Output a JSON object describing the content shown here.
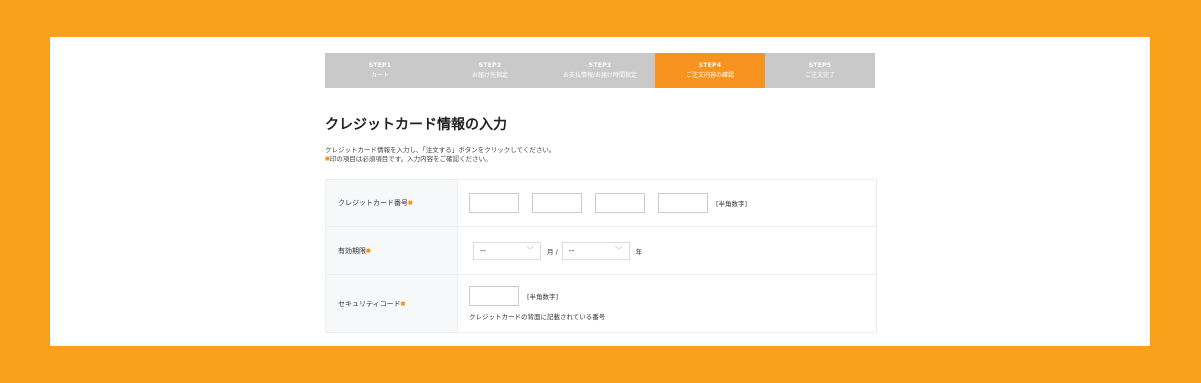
{
  "steps": [
    {
      "num": "STEP1",
      "label": "カート",
      "active": false
    },
    {
      "num": "STEP2",
      "label": "お届け先指定",
      "active": false
    },
    {
      "num": "STEP3",
      "label": "お支払情報/お届け時間指定",
      "active": false
    },
    {
      "num": "STEP4",
      "label": "ご注文内容の確認",
      "active": true
    },
    {
      "num": "STEP5",
      "label": "ご注文完了",
      "active": false
    }
  ],
  "title": "クレジットカード情報の入力",
  "desc": {
    "line1": "クレジットカード情報を入力し、「注文する」ボタンをクリックしてください。",
    "required_mark": "■",
    "line2": "印の項目は必須項目です。入力内容をご確認ください。"
  },
  "form": {
    "card_number": {
      "label": "クレジットカード番号",
      "hint": "[半角数字]"
    },
    "expiry": {
      "label": "有効期限",
      "month_value": "--",
      "month_unit": "月 /",
      "year_value": "--",
      "year_unit": "年"
    },
    "security": {
      "label": "セキュリティコード",
      "hint": "[半角数字]",
      "note": "クレジットカードの背面に記載されている番号"
    }
  },
  "colors": {
    "background": "#f9a11b",
    "accent": "#f7931e",
    "step_inactive": "#c9c9c9"
  },
  "icons": {
    "select_arrow": "chevron-down-icon"
  }
}
